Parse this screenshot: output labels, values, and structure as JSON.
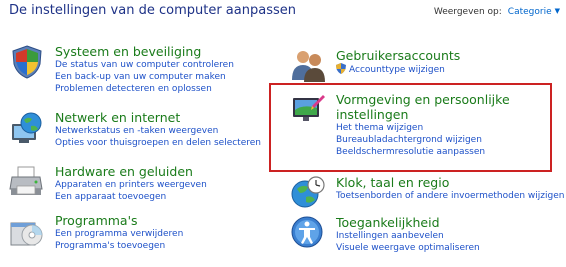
{
  "header": {
    "title": "De instellingen van de computer aanpassen",
    "view_by_label": "Weergeven op:",
    "view_by_value": "Categorie"
  },
  "left_categories": [
    {
      "title": "Systeem en beveiliging",
      "icon": "shield-flag-icon",
      "links": [
        "De status van uw computer controleren",
        "Een back-up van uw computer maken",
        "Problemen detecteren en oplossen"
      ]
    },
    {
      "title": "Netwerk en internet",
      "icon": "globe-network-icon",
      "links": [
        "Netwerkstatus en -taken weergeven",
        "Opties voor thuisgroepen en delen selecteren"
      ]
    },
    {
      "title": "Hardware en geluiden",
      "icon": "printer-icon",
      "links": [
        "Apparaten en printers weergeven",
        "Een apparaat toevoegen"
      ]
    },
    {
      "title": "Programma's",
      "icon": "programs-icon",
      "links": [
        "Een programma verwijderen",
        "Programma's toevoegen"
      ]
    }
  ],
  "right_categories": [
    {
      "title": "Gebruikersaccounts",
      "icon": "users-icon",
      "links": [
        "Accounttype wijzigen"
      ]
    },
    {
      "title": "Vormgeving en persoonlijke instellingen",
      "icon": "appearance-icon",
      "links": [
        "Het thema wijzigen",
        "Bureaubladachtergrond wijzigen",
        "Beeldschermresolutie aanpassen"
      ]
    },
    {
      "title": "Klok, taal en regio",
      "icon": "clock-globe-icon",
      "links": [
        "Toetsenborden of andere invoermethoden wijzigen"
      ]
    },
    {
      "title": "Toegankelijkheid",
      "icon": "accessibility-icon",
      "links": [
        "Instellingen aanbevelen",
        "Visuele weergave optimaliseren"
      ]
    }
  ],
  "colors": {
    "title_blue": "#1e3287",
    "category_green": "#1a7b1a",
    "link_blue": "#1e51c8",
    "highlight_red": "#cc2222"
  }
}
